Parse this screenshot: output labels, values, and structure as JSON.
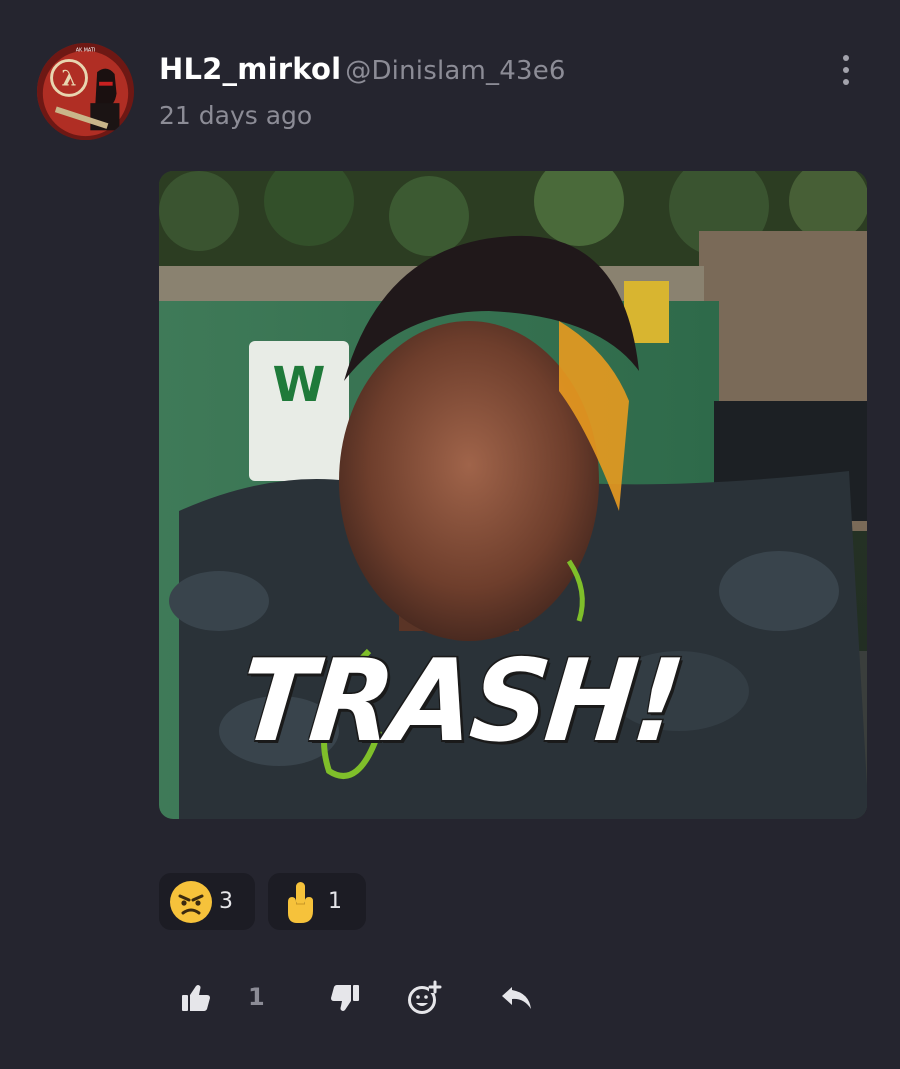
{
  "post": {
    "username": "HL2_mirkol",
    "handle": "@Dinislam_43e6",
    "timestamp": "21 days ago",
    "avatar_text": "AK MATI",
    "media_caption": "TRASH!"
  },
  "reactions": [
    {
      "emoji": "angry-face",
      "count": "3"
    },
    {
      "emoji": "middle-finger",
      "count": "1"
    }
  ],
  "actions": {
    "like_count": "1",
    "icons": [
      "thumbs-up-icon",
      "thumbs-down-icon",
      "add-reaction-icon",
      "reply-icon"
    ]
  },
  "colors": {
    "background": "#25252f",
    "secondary_text": "#8c8c96",
    "reaction_pill": "#1c1c24"
  }
}
